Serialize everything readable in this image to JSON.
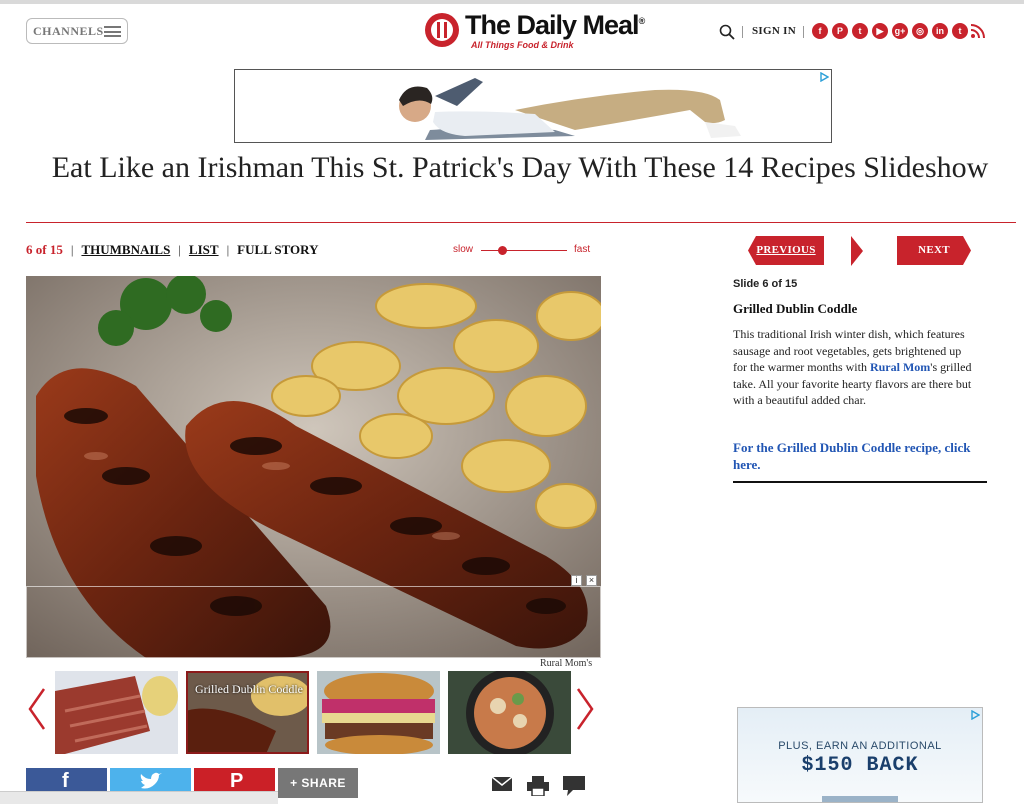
{
  "header": {
    "channels_label": "CHANNELS",
    "logo_name": "The Daily Meal",
    "logo_registered": "®",
    "logo_tagline": "All Things Food & Drink",
    "sign_in": "SIGN IN",
    "social_icons": [
      "facebook-icon",
      "pinterest-icon",
      "twitter-icon",
      "youtube-icon",
      "google-plus-icon",
      "instagram-icon",
      "linkedin-icon",
      "tumblr-icon",
      "rss-icon"
    ],
    "brand_color": "#c8232c"
  },
  "article": {
    "title": "Eat Like an Irishman This St. Patrick's Day With These 14 Recipes Slideshow"
  },
  "slide_nav": {
    "count": "6 of 15",
    "thumbnails": "THUMBNAILS",
    "list": "LIST",
    "full_story": "FULL STORY",
    "speed_slow": "slow",
    "speed_fast": "fast"
  },
  "photo": {
    "credit": "Rural Mom's",
    "overlay_info": "i",
    "overlay_close": "×"
  },
  "thumbnails": [
    {
      "caption": ""
    },
    {
      "caption": "Grilled Dublin Coddle",
      "active": true
    },
    {
      "caption": ""
    },
    {
      "caption": ""
    }
  ],
  "share": {
    "facebook": "f",
    "twitter": "twitter",
    "pinterest": "P",
    "more_label": "SHARE",
    "more_plus": "+"
  },
  "sidebar": {
    "previous": "PREVIOUS",
    "next": "NEXT",
    "slide_number": "Slide 6 of 15",
    "slide_title": "Grilled Dublin Coddle",
    "desc_before": "This traditional Irish winter dish, which features sausage and root vegetables, gets brightened up for the warmer months with ",
    "desc_link": "Rural Mom",
    "desc_after": "'s grilled take. All your favorite hearty flavors are there but with a beautiful added char.",
    "recipe_link": "For the Grilled Dublin Coddle recipe, click here."
  },
  "side_ad": {
    "line1": "PLUS, EARN AN ADDITIONAL",
    "line2": "$150 BACK"
  }
}
